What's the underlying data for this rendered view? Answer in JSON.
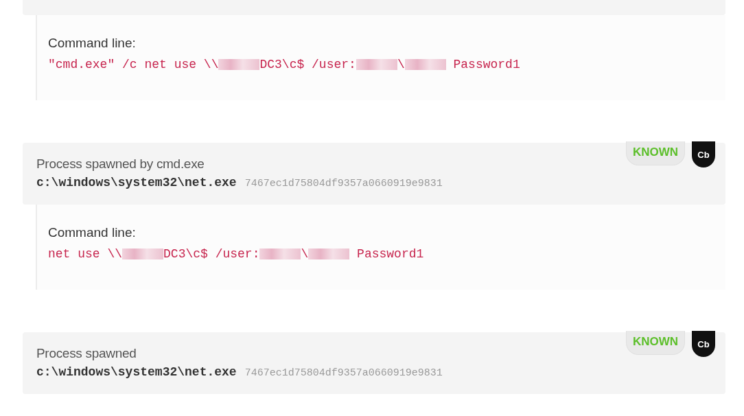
{
  "events": [
    {
      "command": {
        "label": "Command line:",
        "segments": [
          {
            "kind": "text",
            "text": "\"cmd.exe\" /c net use \\\\"
          },
          {
            "kind": "redacted"
          },
          {
            "kind": "text",
            "text": "DC3\\c$ /user:"
          },
          {
            "kind": "redacted"
          },
          {
            "kind": "text",
            "text": "\\"
          },
          {
            "kind": "redacted"
          },
          {
            "kind": "text",
            "text": " Password1"
          }
        ]
      }
    },
    {
      "header": {
        "title": "Process spawned by cmd.exe",
        "path": "c:\\windows\\system32\\net.exe",
        "hash": "7467ec1d75804df9357a0660919e9831",
        "status": "KNOWN",
        "vendor": "Cb"
      },
      "command": {
        "label": "Command line:",
        "segments": [
          {
            "kind": "text",
            "text": "net use \\\\"
          },
          {
            "kind": "redacted"
          },
          {
            "kind": "text",
            "text": "DC3\\c$ /user:"
          },
          {
            "kind": "redacted"
          },
          {
            "kind": "text",
            "text": "\\"
          },
          {
            "kind": "redacted"
          },
          {
            "kind": "text",
            "text": " Password1"
          }
        ]
      }
    },
    {
      "header": {
        "title": "Process spawned",
        "path": "c:\\windows\\system32\\net.exe",
        "hash": "7467ec1d75804df9357a0660919e9831",
        "status": "KNOWN",
        "vendor": "Cb"
      }
    }
  ]
}
